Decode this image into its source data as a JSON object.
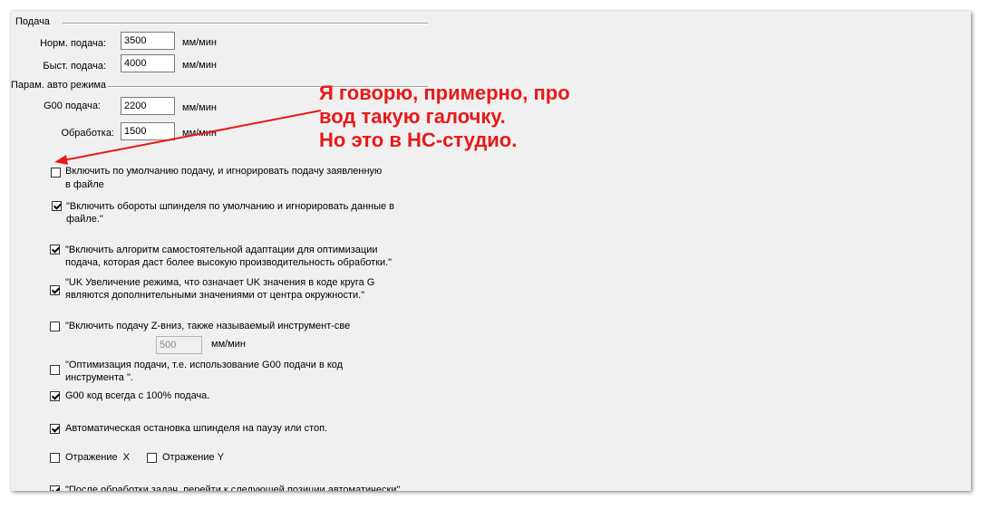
{
  "feed_group": {
    "title": "Подача",
    "normal_feed": {
      "label": "Норм. подача:",
      "value": "3500",
      "unit": "мм/мин"
    },
    "fast_feed": {
      "label": "Быст. подача:",
      "value": "4000",
      "unit": "мм/мин"
    }
  },
  "auto_group": {
    "title": "Парам. авто режима",
    "g00_feed": {
      "label": "G00 подача:",
      "value": "2200",
      "unit": "мм/мин"
    },
    "processing": {
      "label": "Обработка:",
      "value": "1500",
      "unit": "мм/мин"
    }
  },
  "options": [
    {
      "checked": false,
      "line1": "Включить по умолчанию подачу, и игнорировать подачу заявленную",
      "line2": "в файле"
    },
    {
      "checked": true,
      "line1": "\"Включить обороты шпинделя по умолчанию и игнорировать данные в",
      "line2": "файле.\""
    },
    {
      "checked": true,
      "line1": "\"Включить алгоритм самостоятельной адаптации для оптимизации",
      "line2": "подача, которая даст более высокую производительность обработки.\""
    },
    {
      "checked": true,
      "line1": "\"UK Увеличение режима, что означает UK значения в коде круга G",
      "line2": "являются дополнительными значениями от центра окружности.\""
    },
    {
      "checked": false,
      "line1": "\"Включить подачу Z-вниз, также называемый инструмент-све",
      "line2": ""
    },
    {
      "checked": false,
      "line1": "\"Оптимизация подачи, т.е. использование G00 подачи в код",
      "line2": "инструмента \"."
    },
    {
      "checked": true,
      "line1": "G00 код всегда с 100% подача.",
      "line2": ""
    },
    {
      "checked": true,
      "line1": "Автоматическая остановка шпинделя на паузу или стоп.",
      "line2": ""
    },
    {
      "checked": true,
      "line1": "\"После обработки задач, перейти к следующей позиции автоматически\"",
      "line2": ""
    }
  ],
  "zdown": {
    "value": "500",
    "unit": "мм/мин"
  },
  "mirror_x": {
    "checked": false,
    "label": "Отражение  X"
  },
  "mirror_y": {
    "checked": false,
    "label": "Отражение Y"
  },
  "annotation": {
    "line1": "Я говорю, примерно, про",
    "line2": "вод такую галочку.",
    "line3": "Но это в НС-студио.",
    "color": "#e81919"
  }
}
